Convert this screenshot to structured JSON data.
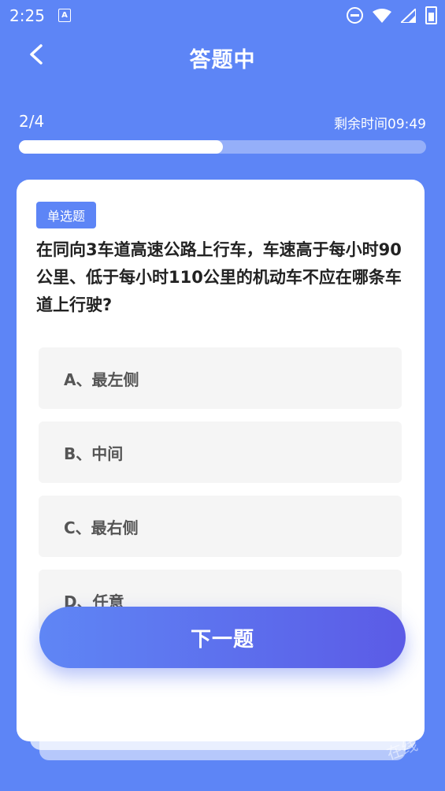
{
  "status_bar": {
    "time": "2:25",
    "app_icon_letter": "A"
  },
  "header": {
    "title": "答题中"
  },
  "progress": {
    "label": "2/4",
    "fraction": 0.5,
    "time_left": "剩余时间09:49"
  },
  "question": {
    "type_badge": "单选题",
    "text": "在同向3车道高速公路上行车，车速高于每小时90公里、低于每小时110公里的机动车不应在哪条车道上行驶?",
    "options": [
      "A、最左侧",
      "B、中间",
      "C、最右侧",
      "D、任意"
    ]
  },
  "next_button": {
    "label": "下一题"
  },
  "watermark": "在线",
  "colors": {
    "background": "#5d85f6",
    "accent": "#5d85f6",
    "button_end": "#5b5be6"
  }
}
